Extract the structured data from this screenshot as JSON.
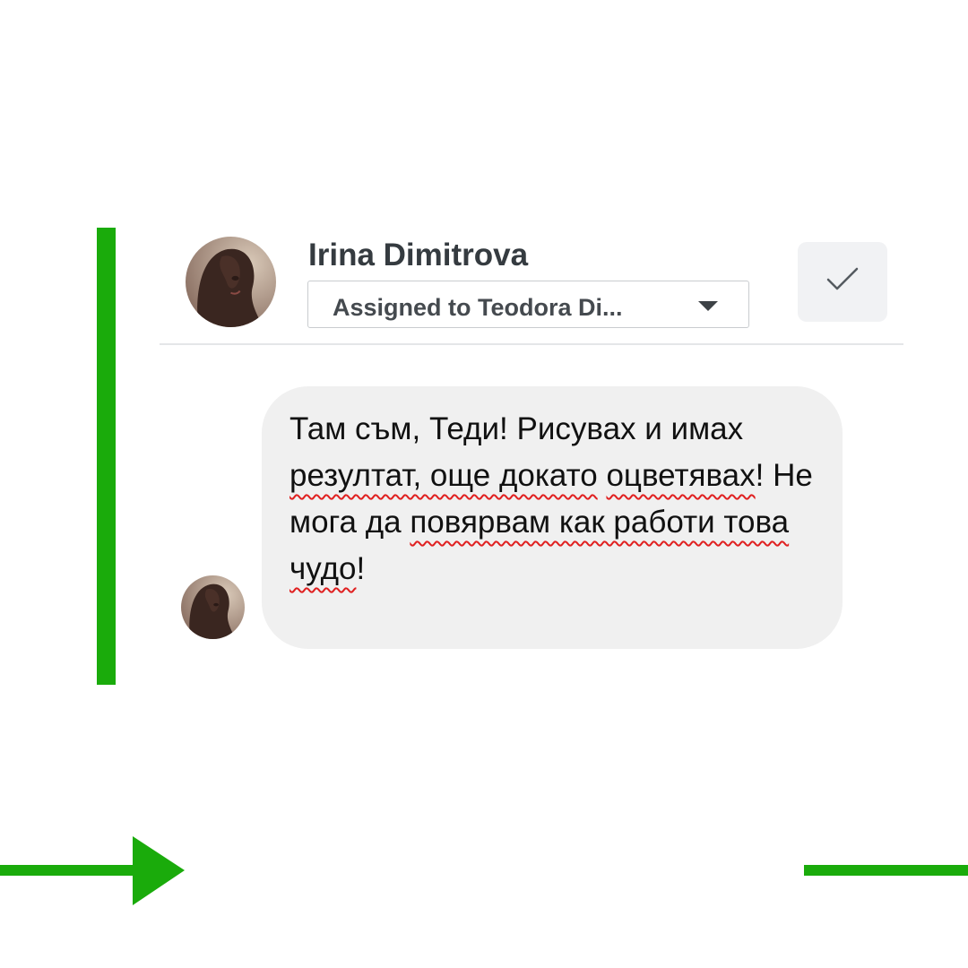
{
  "colors": {
    "accent": "#1aab0b",
    "bubble": "#f0f0f0",
    "spell_error": "#e02020"
  },
  "conversation": {
    "sender_name": "Irina Dimitrova",
    "assignment_label": "Assigned to Teodora Di...",
    "done_icon": "check-icon",
    "dropdown_icon": "caret-down-icon"
  },
  "message": {
    "segments": [
      {
        "text": "Там съм, Теди! Рисувах и имах ",
        "spell_error": false
      },
      {
        "text": "резултат, още докато",
        "spell_error": true
      },
      {
        "text": " ",
        "spell_error": false
      },
      {
        "text": "оцветявах",
        "spell_error": true
      },
      {
        "text": "! Не мога да ",
        "spell_error": false
      },
      {
        "text": "повярвам как работи това",
        "spell_error": true
      },
      {
        "text": " ",
        "spell_error": false
      },
      {
        "text": "чудо",
        "spell_error": true
      },
      {
        "text": "!",
        "spell_error": false
      }
    ]
  }
}
